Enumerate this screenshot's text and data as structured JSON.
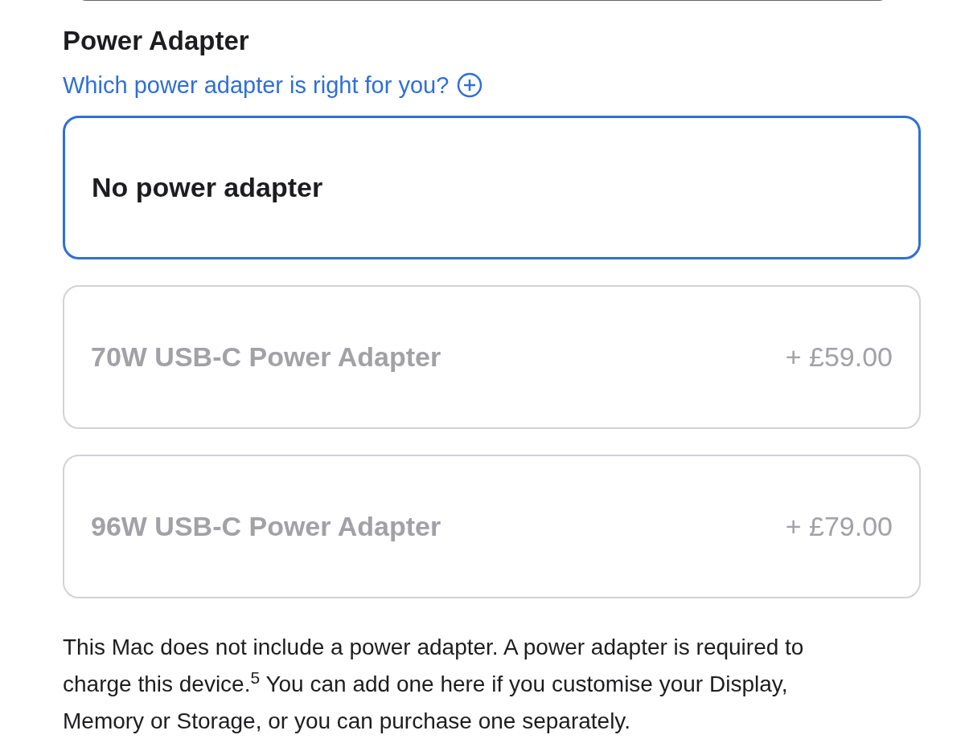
{
  "section": {
    "title": "Power Adapter",
    "help_link": "Which power adapter is right for you?"
  },
  "options": [
    {
      "label": "No power adapter",
      "selected": true,
      "disabled": false
    },
    {
      "label": "70W USB-C Power Adapter",
      "price": "+ £59.00",
      "selected": false,
      "disabled": true
    },
    {
      "label": "96W USB-C Power Adapter",
      "price": "+ £79.00",
      "selected": false,
      "disabled": true
    }
  ],
  "note": "This Mac does not include a power adapter. A power adapter is required to charge this device.$^{5}$ You can add one here if you customise your Display, Memory or Storage, or you can purchase one separately."
}
